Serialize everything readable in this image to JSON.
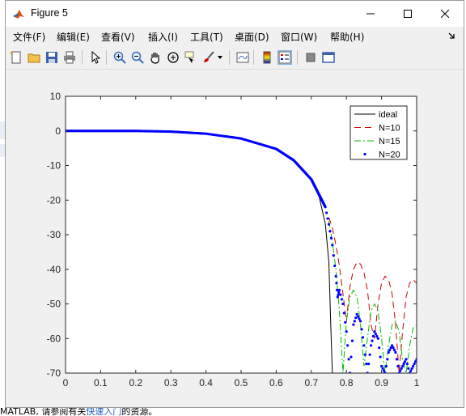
{
  "window": {
    "title": "Figure 5"
  },
  "menu": [
    {
      "label": "文件(F)"
    },
    {
      "label": "编辑(E)"
    },
    {
      "label": "查看(V)"
    },
    {
      "label": "插入(I)"
    },
    {
      "label": "工具(T)"
    },
    {
      "label": "桌面(D)"
    },
    {
      "label": "窗口(W)"
    },
    {
      "label": "帮助(H)"
    }
  ],
  "toolbar_icons": [
    "new-figure-icon",
    "open-file-icon",
    "save-icon",
    "print-icon",
    "edit-plot-arrow-icon",
    "zoom-in-icon",
    "zoom-out-icon",
    "pan-hand-icon",
    "rotate-3d-icon",
    "data-cursor-icon",
    "brush-icon",
    "brush-dropdown-icon",
    "link-plot-icon",
    "colorbar-icon",
    "legend-icon",
    "hide-plot-tools-icon",
    "show-plot-tools-icon"
  ],
  "background_status": {
    "prefix": "MATLAB, 请参阅有关",
    "link": "快速入门",
    "suffix": "的资源。"
  },
  "chart_data": {
    "type": "line",
    "title": "",
    "xlabel": "",
    "ylabel": "",
    "xlim": [
      0,
      1
    ],
    "ylim": [
      -70,
      10
    ],
    "xticks": [
      "0",
      "0.1",
      "0.2",
      "0.3",
      "0.4",
      "0.5",
      "0.6",
      "0.7",
      "0.8",
      "0.9",
      "1"
    ],
    "yticks": [
      "10",
      "0",
      "-10",
      "-20",
      "-30",
      "-40",
      "-50",
      "-60",
      "-70"
    ],
    "grid": false,
    "legend_position": "top-right",
    "series": [
      {
        "name": "ideal",
        "color": "#000000",
        "style": "solid",
        "x": [
          0,
          0.1,
          0.2,
          0.3,
          0.4,
          0.5,
          0.6,
          0.65,
          0.7,
          0.72,
          0.74,
          0.75,
          0.755,
          0.76
        ],
        "y": [
          0,
          0,
          0,
          -0.2,
          -0.8,
          -2.2,
          -5.2,
          -8.5,
          -14,
          -18,
          -27,
          -38,
          -55,
          -70
        ]
      },
      {
        "name": "N=10",
        "color": "#cc0000",
        "style": "dashed",
        "x": [
          0.75,
          0.76,
          0.77,
          0.78,
          0.79,
          0.8,
          0.81,
          0.82,
          0.83,
          0.84,
          0.85,
          0.86,
          0.87,
          0.88,
          0.89,
          0.9,
          0.91,
          0.92,
          0.93,
          0.94,
          0.95,
          0.96,
          0.97,
          0.98,
          0.99,
          1.0
        ],
        "y": [
          -25,
          -28,
          -33,
          -39,
          -47,
          -55,
          -45,
          -40,
          -38,
          -38.5,
          -41,
          -46,
          -56,
          -60,
          -50,
          -44,
          -42,
          -43,
          -47,
          -56,
          -70,
          -58,
          -48,
          -44,
          -43,
          -44
        ]
      },
      {
        "name": "N=15",
        "color": "#00bb00",
        "style": "dashdot",
        "x": [
          0.75,
          0.76,
          0.77,
          0.78,
          0.79,
          0.8,
          0.81,
          0.82,
          0.83,
          0.84,
          0.85,
          0.86,
          0.87,
          0.88,
          0.89,
          0.9,
          0.91,
          0.92,
          0.93,
          0.94,
          0.95,
          0.96,
          0.97,
          0.98,
          0.99,
          1.0
        ],
        "y": [
          -26,
          -32,
          -40,
          -52,
          -70,
          -55,
          -48,
          -46,
          -48,
          -56,
          -68,
          -60,
          -52,
          -50,
          -52,
          -60,
          -70,
          -62,
          -56,
          -55,
          -58,
          -66,
          -70,
          -62,
          -57,
          -56
        ]
      },
      {
        "name": "N=20",
        "color": "#0000ff",
        "style": "dotted",
        "x": [
          0.74,
          0.75,
          0.76,
          0.77,
          0.775,
          0.78,
          0.79,
          0.8,
          0.81,
          0.82,
          0.83,
          0.84,
          0.85,
          0.86,
          0.87,
          0.88,
          0.89,
          0.9,
          0.91,
          0.92,
          0.93,
          0.94,
          0.95,
          0.96,
          0.97,
          0.98,
          0.99,
          1.0
        ],
        "y": [
          -22,
          -27,
          -33,
          -42,
          -48,
          -46,
          -50,
          -58,
          -70,
          -56,
          -53,
          -55,
          -62,
          -70,
          -62,
          -58,
          -60,
          -68,
          -70,
          -64,
          -62,
          -64,
          -70,
          -68,
          -66,
          -70,
          -68,
          -66
        ]
      }
    ],
    "passband": {
      "x": [
        0,
        0.1,
        0.2,
        0.3,
        0.4,
        0.5,
        0.6,
        0.65,
        0.7,
        0.72,
        0.74
      ],
      "y": [
        0,
        0,
        0,
        -0.2,
        -0.8,
        -2.2,
        -5.2,
        -8.5,
        -14,
        -18,
        -22
      ]
    }
  }
}
